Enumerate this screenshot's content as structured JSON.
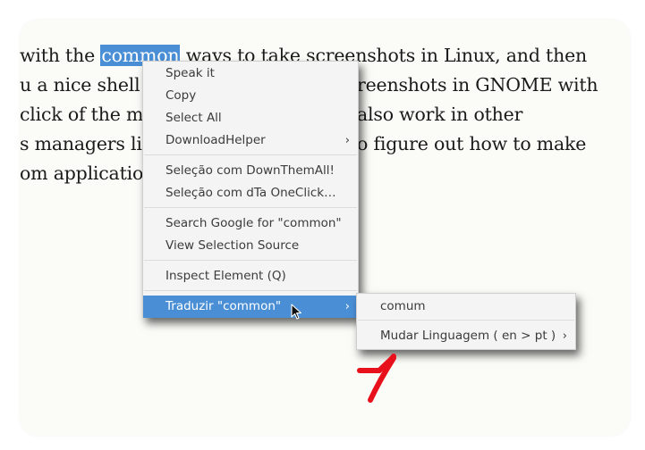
{
  "article": {
    "line1_pre": "with the ",
    "line1_highlight": "common",
    "line1_post": " ways to take screenshots in Linux, and then",
    "line2_left": "u a nice shell s",
    "line2_right": "reenshots in GNOME with",
    "line3_left": "click of the mo",
    "line3_right": "also work in other",
    "line4_left": "s managers lik",
    "line4_right": "o figure out how to make",
    "line5_left": "om application",
    "stray_mark": "."
  },
  "context_menu": {
    "speak_it": "Speak it",
    "copy": "Copy",
    "select_all": "Select All",
    "download_helper": "DownloadHelper",
    "selecao_dta": "Seleção com DownThemAll!",
    "selecao_oneclick": "Seleção com dTa OneClick…",
    "search_google": "Search Google for \"common\"",
    "view_selection_source": "View Selection Source",
    "inspect_element": "Inspect Element (Q)",
    "traduzir": "Traduzir \"common\"",
    "submenu_chevron": "›"
  },
  "translate_submenu": {
    "result": "comum",
    "change_language": "Mudar Linguagem ( en > pt )",
    "submenu_chevron": "›"
  },
  "colors": {
    "selection_blue": "#4a8fd6",
    "annotation_red": "#e8101a"
  }
}
